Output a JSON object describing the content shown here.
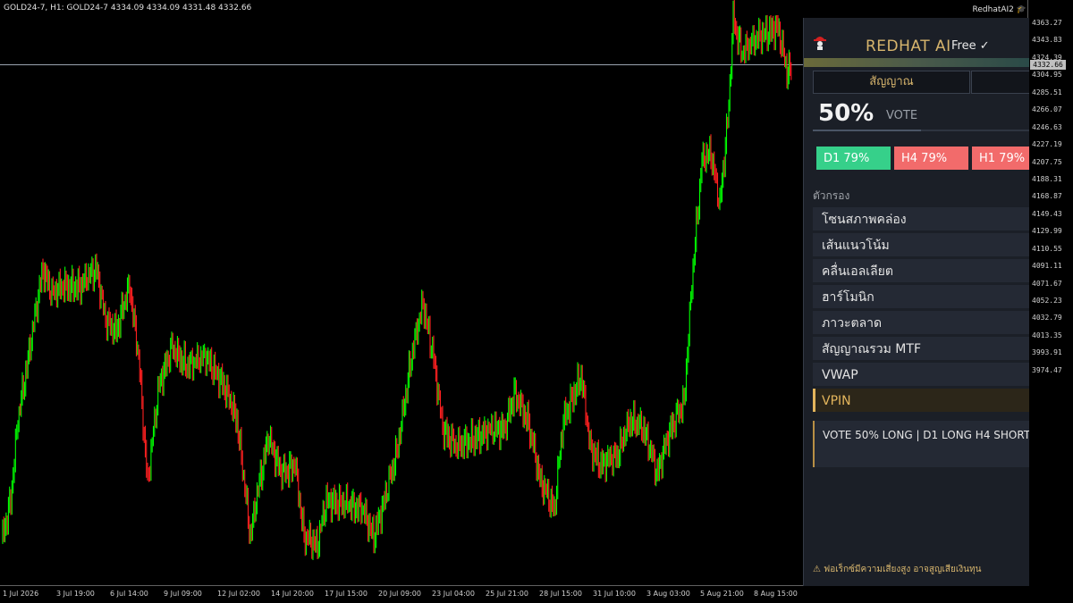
{
  "chart": {
    "title": "GOLD24-7, H1:  GOLD24-7  4334.09 4334.09 4331.48 4332.66",
    "indicator_label": "RedhatAI2",
    "current_price": "4332.66",
    "y_labels": [
      "4363.27",
      "4343.83",
      "4324.39",
      "4304.95",
      "4285.51",
      "4266.07",
      "4246.63",
      "4227.19",
      "4207.75",
      "4188.31",
      "4168.87",
      "4149.43",
      "4129.99",
      "4110.55",
      "4091.11",
      "4071.67",
      "4052.23",
      "4032.79",
      "4013.35",
      "3993.91",
      "3974.47"
    ],
    "x_labels": [
      "1 Jul 2026",
      "3 Jul 19:00",
      "6 Jul 14:00",
      "9 Jul 09:00",
      "12 Jul 02:00",
      "14 Jul 20:00",
      "17 Jul 15:00",
      "20 Jul 09:00",
      "23 Jul 04:00",
      "25 Jul 21:00",
      "28 Jul 15:00",
      "31 Jul 10:00",
      "3 Aug 03:00",
      "5 Aug 21:00",
      "8 Aug 15:00"
    ],
    "colors": {
      "up": "#00ff00",
      "down": "#ff2020",
      "background": "#000000",
      "hline": "#9aa4b0"
    }
  },
  "panel": {
    "brand": "REDHAT AI",
    "plan": "Free ✓",
    "tabs": [
      {
        "label": "สัญญาณ"
      },
      {
        "label": ""
      }
    ],
    "vote": {
      "percent": "50%",
      "label": "VOTE",
      "fill": 0.5
    },
    "timeframes": [
      {
        "label": "D1 79%",
        "color": "#36d08a"
      },
      {
        "label": "H4 79%",
        "color": "#f26b6b"
      },
      {
        "label": "H1 79%",
        "color": "#f26b6b"
      }
    ],
    "filters_heading": "ตัวกรอง",
    "filters": [
      {
        "label": "โซนสภาพคล่อง",
        "active": false
      },
      {
        "label": "เส้นแนวโน้ม",
        "active": false
      },
      {
        "label": "คลื่นเอลเลียต",
        "active": false
      },
      {
        "label": "ฮาร์โมนิก",
        "active": false
      },
      {
        "label": "ภาวะตลาด",
        "active": false
      },
      {
        "label": "สัญญาณรวม MTF",
        "active": false
      },
      {
        "label": "VWAP",
        "active": false
      },
      {
        "label": "VPIN",
        "active": true
      }
    ],
    "message": "VOTE 50% LONG | D1 LONG H4 SHORT",
    "warning": "⚠ ฟอเร็กซ์มีความเสี่ยงสูง อาจสูญเสียเงินทุน"
  }
}
